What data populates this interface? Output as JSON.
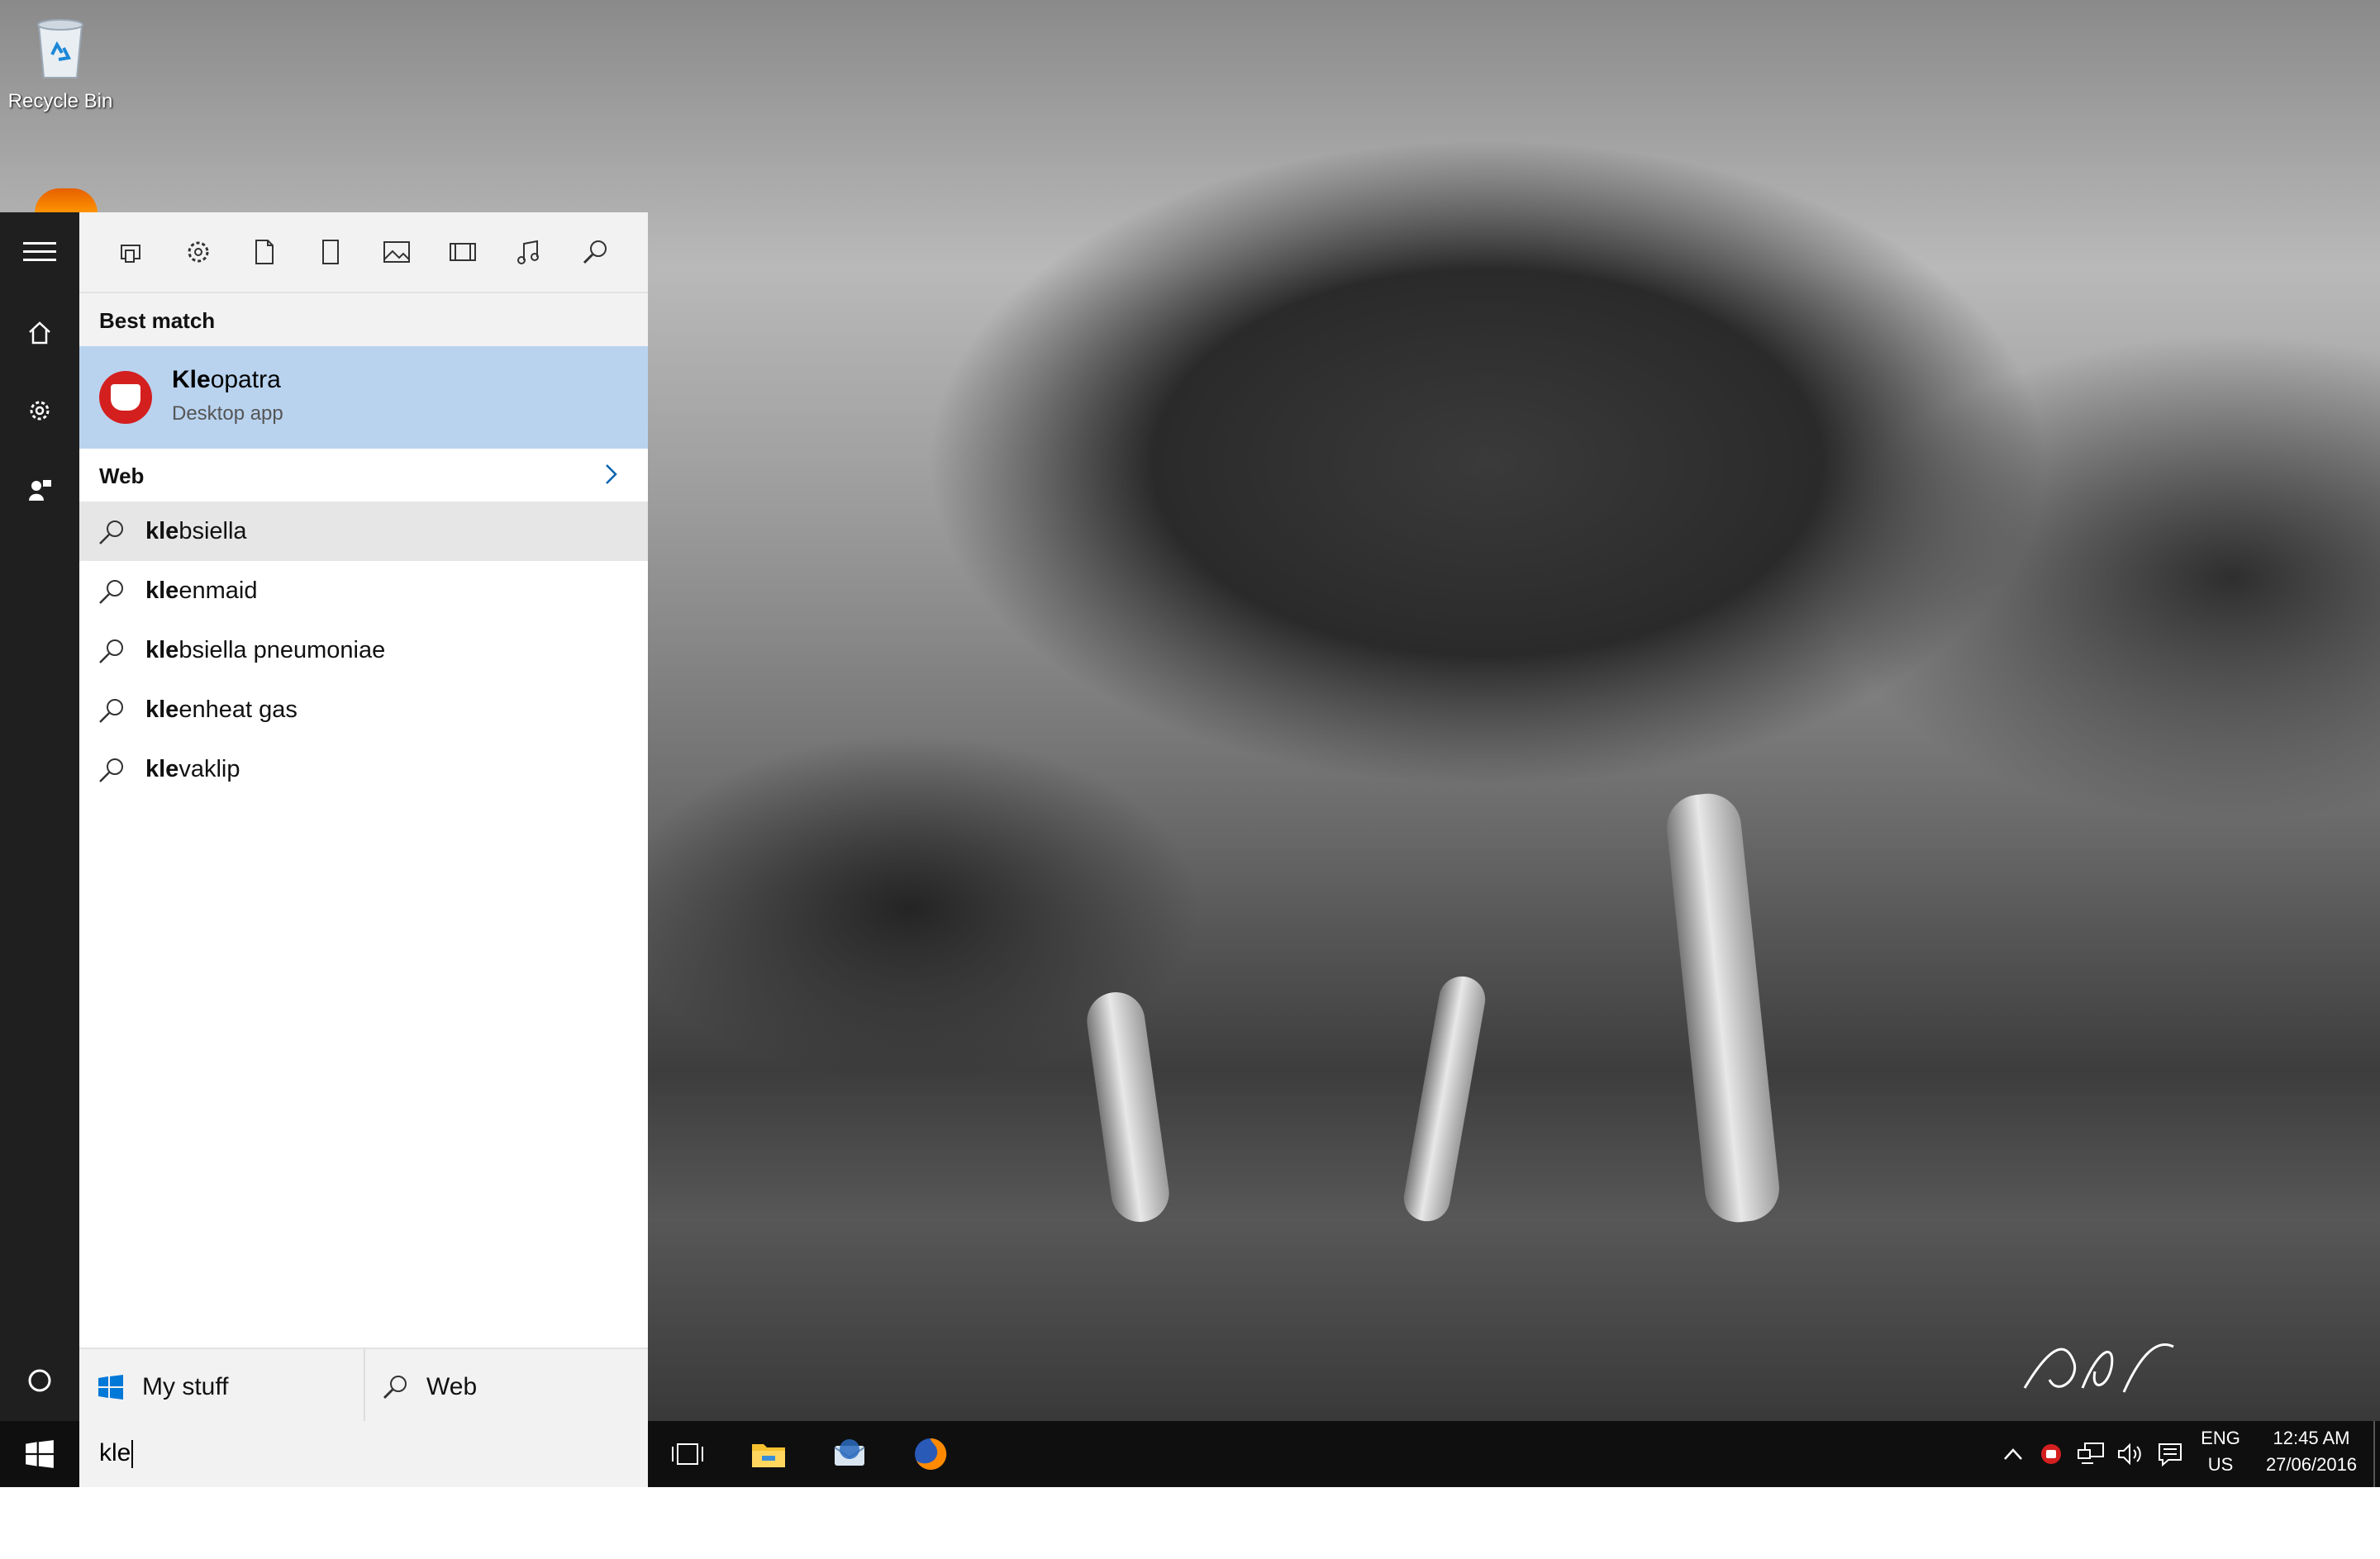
{
  "desktop": {
    "recycle_bin_label": "Recycle Bin"
  },
  "start_menu": {
    "best_match_heading": "Best match",
    "best_match": {
      "match_prefix": "Kle",
      "match_rest": "opatra",
      "subtitle": "Desktop app"
    },
    "web_heading": "Web",
    "suggestions": [
      {
        "prefix": "kle",
        "rest": "bsiella"
      },
      {
        "prefix": "kle",
        "rest": "enmaid"
      },
      {
        "prefix": "kle",
        "rest": "bsiella pneumoniae"
      },
      {
        "prefix": "kle",
        "rest": "enheat gas"
      },
      {
        "prefix": "kle",
        "rest": "vaklip"
      }
    ],
    "scope_my_stuff": "My stuff",
    "scope_web": "Web",
    "filters": [
      "apps-icon",
      "settings-icon",
      "documents-icon",
      "folders-icon",
      "photos-icon",
      "videos-icon",
      "music-icon",
      "web-search-icon"
    ]
  },
  "search": {
    "query": "kle"
  },
  "taskbar": {
    "apps": [
      "task-view-icon",
      "file-explorer-icon",
      "thunderbird-icon",
      "firefox-icon"
    ],
    "language_top": "ENG",
    "language_bottom": "US",
    "time": "12:45 AM",
    "date": "27/06/2016"
  },
  "colors": {
    "accent_selection": "#b9d3ef",
    "taskbar": "#0f0f0f",
    "start_rail": "#1f1f1f",
    "panel": "#f2f2f2"
  }
}
